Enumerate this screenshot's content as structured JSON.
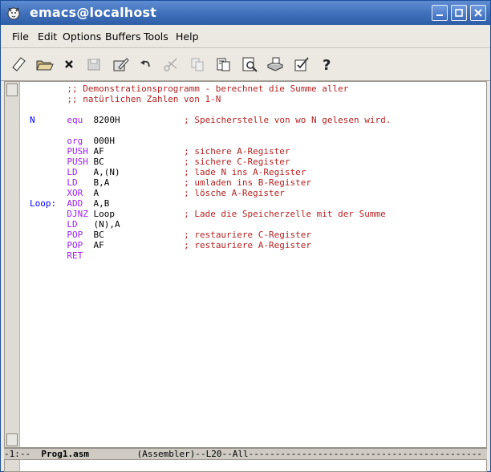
{
  "window": {
    "title": "emacs@localhost"
  },
  "menu": [
    "File",
    "Edit",
    "Options",
    "Buffers",
    "Tools",
    "Help"
  ],
  "toolbar": {
    "buttons": [
      "new-file-icon",
      "open-folder-icon",
      "close-buffer-icon",
      "save-disk-icon",
      "save-as-icon",
      "undo-icon",
      "cut-icon",
      "copy-icon",
      "paste-icon",
      "search-icon",
      "print-icon",
      "preferences-icon",
      "help-icon"
    ]
  },
  "code": {
    "lines": [
      {
        "label": "",
        "op": "",
        "args": "",
        "comment": ";; Demonstrationsprogramm - berechnet die Summe aller"
      },
      {
        "label": "",
        "op": "",
        "args": "",
        "comment": ";; natürlichen Zahlen von 1-N"
      },
      {
        "label": "",
        "op": "",
        "args": "",
        "comment": ""
      },
      {
        "label": "N",
        "op": "equ",
        "args": "8200H",
        "comment": "; Speicherstelle von wo N gelesen wird."
      },
      {
        "label": "",
        "op": "",
        "args": "",
        "comment": ""
      },
      {
        "label": "",
        "op": "org",
        "args": "000H",
        "comment": ""
      },
      {
        "label": "",
        "op": "PUSH",
        "args": "AF",
        "comment": "; sichere A-Register"
      },
      {
        "label": "",
        "op": "PUSH",
        "args": "BC",
        "comment": "; sichere C-Register"
      },
      {
        "label": "",
        "op": "LD",
        "args": "A,(N)",
        "comment": "; lade N ins A-Register"
      },
      {
        "label": "",
        "op": "LD",
        "args": "B,A",
        "comment": "; umladen ins B-Register"
      },
      {
        "label": "",
        "op": "XOR",
        "args": "A",
        "comment": "; lösche A-Register"
      },
      {
        "label": "Loop:",
        "op": "ADD",
        "args": "A,B",
        "comment": ""
      },
      {
        "label": "",
        "op": "DJNZ",
        "args": "Loop",
        "comment": "; Lade die Speicherzelle mit der Summe"
      },
      {
        "label": "",
        "op": "LD",
        "args": "(N),A",
        "comment": ""
      },
      {
        "label": "",
        "op": "POP",
        "args": "BC",
        "comment": "; restauriere C-Register"
      },
      {
        "label": "",
        "op": "POP",
        "args": "AF",
        "comment": "; restauriere A-Register"
      },
      {
        "label": "",
        "op": "RET",
        "args": "",
        "comment": ""
      }
    ]
  },
  "modeline": {
    "prefix": "-1:--  ",
    "buffer": "Prog1.asm",
    "rest": "         (Assembler)--L20--All--------------------------------------------"
  },
  "colors": {
    "comment": "#b22222",
    "keyword": "#a020f0",
    "label": "#0000ff",
    "titlebar": "#3f6fba"
  }
}
